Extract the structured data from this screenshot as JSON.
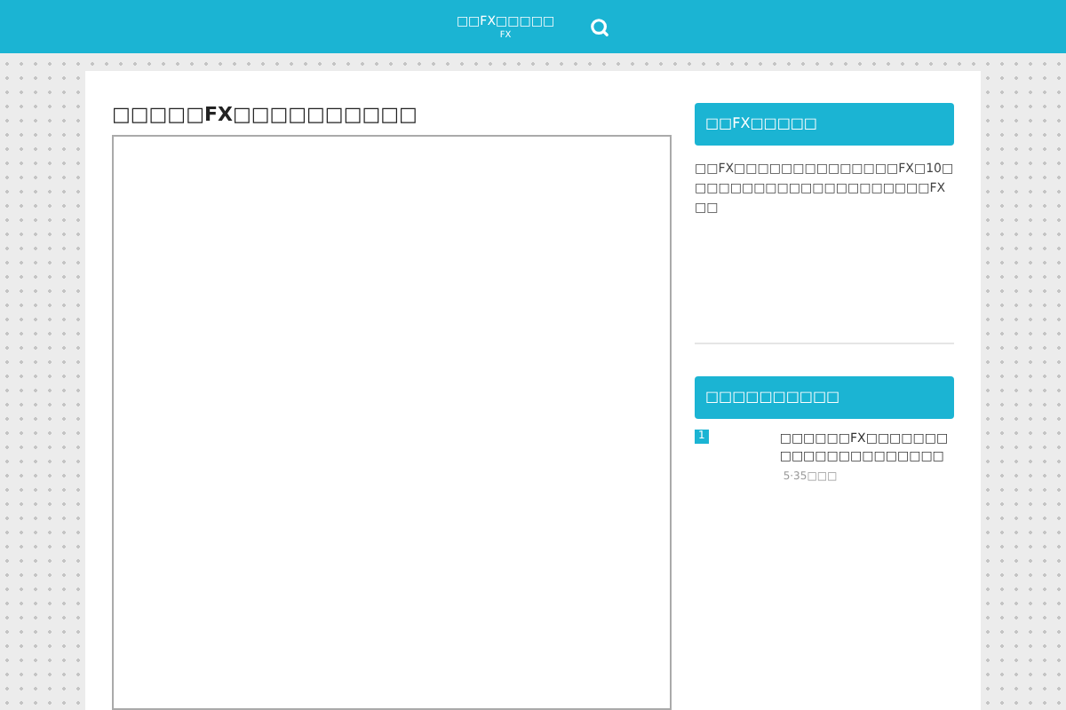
{
  "header": {
    "site_title": "□□FX□□□□□",
    "site_subtitle": "FX"
  },
  "article": {
    "title": "□□□□□FX□□□□□□□□□□"
  },
  "sidebar": {
    "widgets": [
      {
        "kind": "text",
        "title": "□□FX□□□□□",
        "body": "□□FX□□□□□□□□□□□□□□FX□10□□□□□□□□□□□□□□□□□□□□□FX□□"
      },
      {
        "kind": "ranking",
        "title": "□□□□□□□□□□",
        "items": [
          {
            "rank": "1",
            "title": "□□□□□□FX□□□□□□□□□□□□□□□□□□□□□",
            "meta": "5·35□□□"
          }
        ]
      }
    ]
  }
}
